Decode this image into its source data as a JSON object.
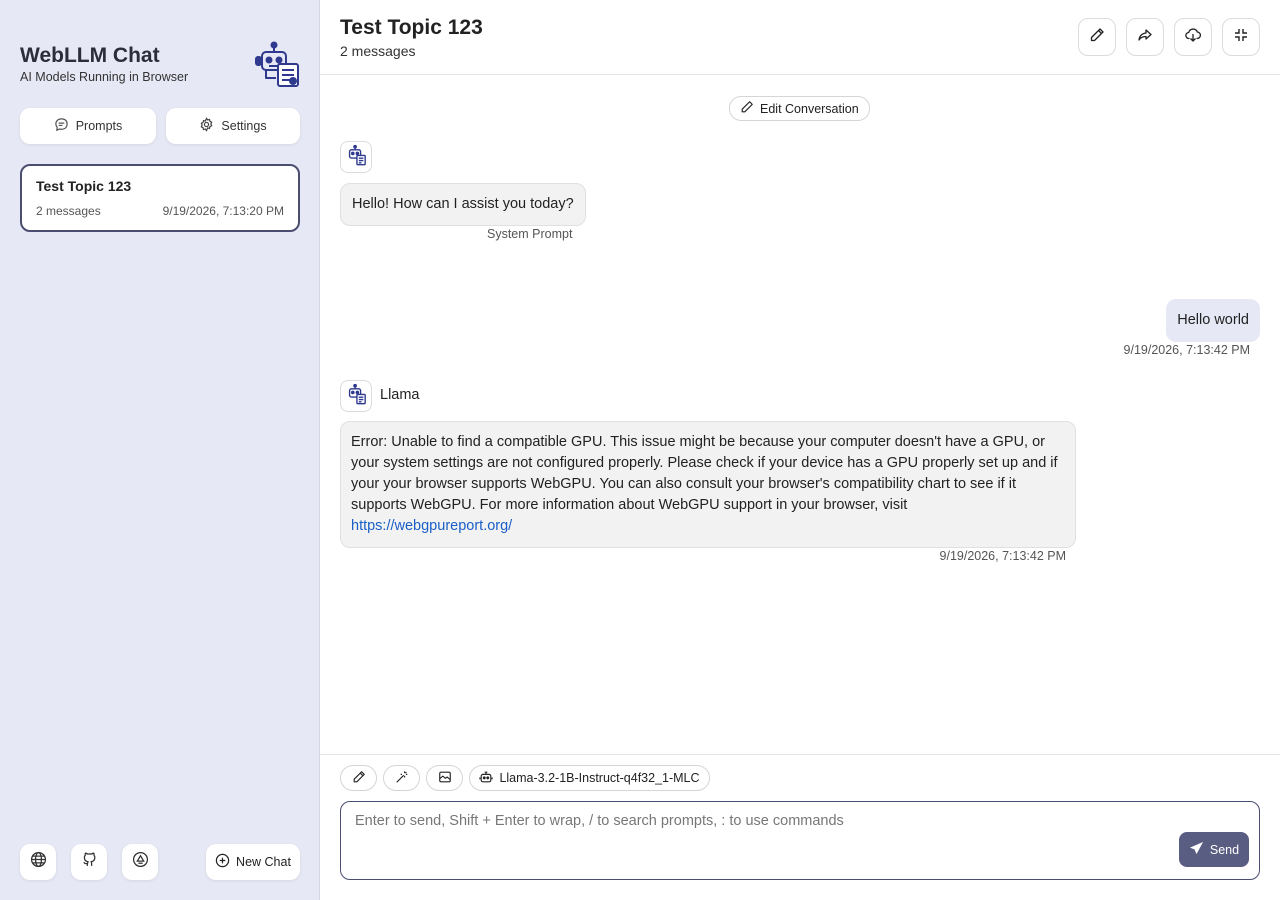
{
  "sidebar": {
    "title": "WebLLM Chat",
    "subtitle": "AI Models Running in Browser",
    "prompts_label": "Prompts",
    "settings_label": "Settings",
    "chats": [
      {
        "title": "Test Topic 123",
        "count": "2 messages",
        "date": "9/19/2026, 7:13:20 PM"
      }
    ],
    "footer_icons": [
      "globe-icon",
      "github-icon",
      "sync-icon"
    ],
    "new_chat_label": "New Chat"
  },
  "header": {
    "title": "Test Topic 123",
    "subtitle": "2 messages",
    "buttons": [
      "edit-icon",
      "share-icon",
      "download-icon",
      "collapse-icon"
    ]
  },
  "conversation": {
    "edit_label": "Edit Conversation",
    "messages": [
      {
        "role": "assistant",
        "text": "Hello! How can I assist you today?",
        "note": "System Prompt"
      },
      {
        "role": "user",
        "text": "Hello world",
        "date": "9/19/2026, 7:13:42 PM"
      },
      {
        "role": "assistant",
        "name": "Llama",
        "text": "Error: Unable to find a compatible GPU. This issue might be because your computer doesn't have a GPU, or your system settings are not configured properly. Please check if your device has a GPU properly set up and if your your browser supports WebGPU. You can also consult your browser's compatibility chart to see if it supports WebGPU. For more information about WebGPU support in your browser, visit",
        "link": "https://webgpureport.org/",
        "date": "9/19/2026, 7:13:42 PM"
      }
    ]
  },
  "composer": {
    "tools": [
      "pen-icon",
      "magic-wand-icon",
      "image-icon"
    ],
    "model": "Llama-3.2-1B-Instruct-q4f32_1-MLC",
    "placeholder": "Enter to send, Shift + Enter to wrap, / to search prompts, : to use commands",
    "send_label": "Send"
  },
  "colors": {
    "sidebar_bg": "#e7e8f5",
    "accent": "#4b4d70",
    "send_bg": "#5a5d82",
    "link": "#1a5fc7"
  }
}
